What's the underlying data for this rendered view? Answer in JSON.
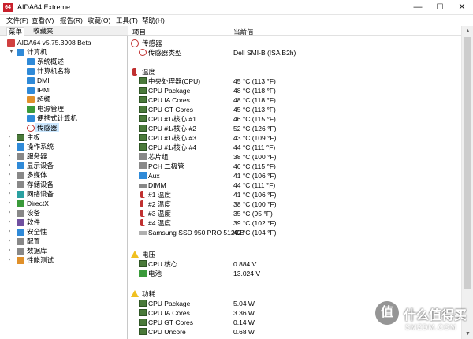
{
  "window": {
    "app_icon_text": "64",
    "title": "AIDA64 Extreme",
    "minimize": "—",
    "maximize": "☐",
    "close": "✕"
  },
  "menu": [
    "文件(F)",
    "查看(V)",
    "报告(R)",
    "收藏(O)",
    "工具(T)",
    "帮助(H)"
  ],
  "tabs": [
    "菜单",
    "收藏夹"
  ],
  "tree": [
    {
      "label": "AIDA64 v5.75.3908 Beta",
      "icon": "aida-icon",
      "level": 0,
      "expander": ""
    },
    {
      "label": "计算机",
      "icon": "computer-icon",
      "level": 0,
      "expander": "▼"
    },
    {
      "label": "系统概述",
      "icon": "monitor-icon",
      "level": 1,
      "expander": ""
    },
    {
      "label": "计算机名称",
      "icon": "monitor-icon",
      "level": 1,
      "expander": ""
    },
    {
      "label": "DMI",
      "icon": "monitor-icon",
      "level": 1,
      "expander": ""
    },
    {
      "label": "IPMI",
      "icon": "monitor-icon",
      "level": 1,
      "expander": ""
    },
    {
      "label": "超频",
      "icon": "fire-icon",
      "level": 1,
      "expander": ""
    },
    {
      "label": "电源管理",
      "icon": "power-icon",
      "level": 1,
      "expander": ""
    },
    {
      "label": "便携式计算机",
      "icon": "laptop-icon",
      "level": 1,
      "expander": ""
    },
    {
      "label": "传感器",
      "icon": "sensor-icon",
      "level": 1,
      "expander": "",
      "selected": true
    },
    {
      "label": "主板",
      "icon": "motherboard-icon",
      "level": 0,
      "expander": "›"
    },
    {
      "label": "操作系统",
      "icon": "windows-icon",
      "level": 0,
      "expander": "›"
    },
    {
      "label": "服务器",
      "icon": "server-icon",
      "level": 0,
      "expander": "›"
    },
    {
      "label": "显示设备",
      "icon": "display-icon",
      "level": 0,
      "expander": "›"
    },
    {
      "label": "多媒体",
      "icon": "multimedia-icon",
      "level": 0,
      "expander": "›"
    },
    {
      "label": "存储设备",
      "icon": "storage-icon",
      "level": 0,
      "expander": "›"
    },
    {
      "label": "网络设备",
      "icon": "network-icon",
      "level": 0,
      "expander": "›"
    },
    {
      "label": "DirectX",
      "icon": "directx-icon",
      "level": 0,
      "expander": "›"
    },
    {
      "label": "设备",
      "icon": "devices-icon",
      "level": 0,
      "expander": "›"
    },
    {
      "label": "软件",
      "icon": "software-icon",
      "level": 0,
      "expander": "›"
    },
    {
      "label": "安全性",
      "icon": "security-icon",
      "level": 0,
      "expander": "›"
    },
    {
      "label": "配置",
      "icon": "config-icon",
      "level": 0,
      "expander": "›"
    },
    {
      "label": "数据库",
      "icon": "database-icon",
      "level": 0,
      "expander": "›"
    },
    {
      "label": "性能测试",
      "icon": "benchmark-icon",
      "level": 0,
      "expander": "›"
    }
  ],
  "columns": {
    "item": "项目",
    "value": "当前值"
  },
  "sections": [
    {
      "title": "传感器",
      "icon": "sensor-icon",
      "items": [
        {
          "label": "传感器类型",
          "value": "Dell SMI-B  (ISA B2h)",
          "icon": "sensor-icon"
        }
      ]
    },
    {
      "title": "温度",
      "icon": "thermometer-icon",
      "items": [
        {
          "label": "中央处理器(CPU)",
          "value": "45 °C  (113 °F)",
          "icon": "chip-icon"
        },
        {
          "label": "CPU Package",
          "value": "48 °C  (118 °F)",
          "icon": "chip-icon"
        },
        {
          "label": "CPU IA Cores",
          "value": "48 °C  (118 °F)",
          "icon": "chip-icon"
        },
        {
          "label": "CPU GT Cores",
          "value": "45 °C  (113 °F)",
          "icon": "chip-icon"
        },
        {
          "label": "CPU #1/核心 #1",
          "value": "46 °C  (115 °F)",
          "icon": "chip-icon"
        },
        {
          "label": "CPU #1/核心 #2",
          "value": "52 °C  (126 °F)",
          "icon": "chip-icon"
        },
        {
          "label": "CPU #1/核心 #3",
          "value": "43 °C  (109 °F)",
          "icon": "chip-icon"
        },
        {
          "label": "CPU #1/核心 #4",
          "value": "44 °C  (111 °F)",
          "icon": "chip-icon"
        },
        {
          "label": "芯片组",
          "value": "38 °C  (100 °F)",
          "icon": "chipset-icon"
        },
        {
          "label": "PCH 二极管",
          "value": "46 °C  (115 °F)",
          "icon": "chipset-icon"
        },
        {
          "label": "Aux",
          "value": "41 °C  (106 °F)",
          "icon": "monitor-icon"
        },
        {
          "label": "DIMM",
          "value": "44 °C  (111 °F)",
          "icon": "memory-icon"
        },
        {
          "label": "#1 温度",
          "value": "41 °C  (106 °F)",
          "icon": "thermometer-icon"
        },
        {
          "label": "#2 温度",
          "value": "38 °C  (100 °F)",
          "icon": "thermometer-icon"
        },
        {
          "label": "#3 温度",
          "value": "35 °C  (95 °F)",
          "icon": "thermometer-icon"
        },
        {
          "label": "#4 温度",
          "value": "39 °C  (102 °F)",
          "icon": "thermometer-icon"
        },
        {
          "label": "Samsung SSD 950 PRO 512GB",
          "value": "40 °C  (104 °F)",
          "icon": "ssd-icon"
        }
      ]
    },
    {
      "title": "电压",
      "icon": "warning-icon",
      "items": [
        {
          "label": "CPU 核心",
          "value": "0.884 V",
          "icon": "chip-icon"
        },
        {
          "label": "电池",
          "value": "13.024 V",
          "icon": "battery-icon"
        }
      ]
    },
    {
      "title": "功耗",
      "icon": "warning-icon",
      "items": [
        {
          "label": "CPU Package",
          "value": "5.04 W",
          "icon": "chip-icon"
        },
        {
          "label": "CPU IA Cores",
          "value": "3.36 W",
          "icon": "chip-icon"
        },
        {
          "label": "CPU GT Cores",
          "value": "0.14 W",
          "icon": "chip-icon"
        },
        {
          "label": "CPU Uncore",
          "value": "0.68 W",
          "icon": "chip-icon"
        }
      ]
    }
  ],
  "watermark": {
    "icon_text": "值",
    "text": "什么值得买",
    "sub": "SMZDM.COM"
  }
}
